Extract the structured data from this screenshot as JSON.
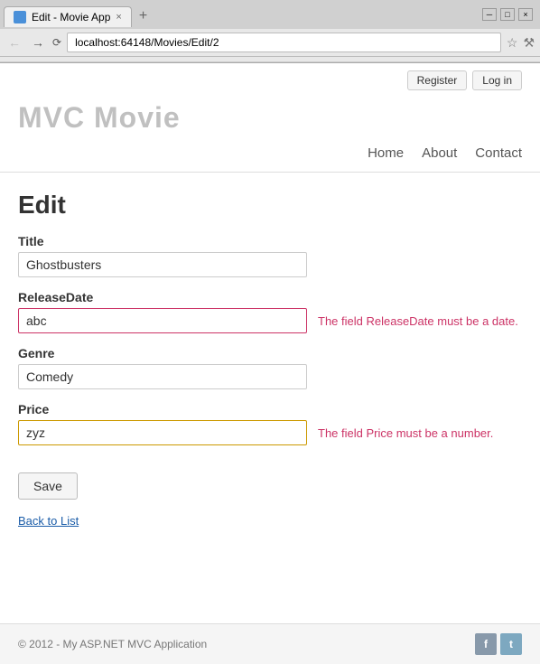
{
  "browser": {
    "tab_title": "Edit - Movie App",
    "tab_close": "×",
    "new_tab": "+",
    "url": "localhost:64148/Movies/Edit/2",
    "win_minimize": "─",
    "win_maximize": "□",
    "win_close": "×"
  },
  "header": {
    "site_title": "MVC Movie",
    "register_label": "Register",
    "login_label": "Log in",
    "nav": {
      "home": "Home",
      "about": "About",
      "contact": "Contact"
    }
  },
  "form": {
    "heading": "Edit",
    "title_label": "Title",
    "title_value": "Ghostbusters",
    "release_label": "ReleaseDate",
    "release_value": "abc",
    "release_error": "The field ReleaseDate must be a date.",
    "genre_label": "Genre",
    "genre_value": "Comedy",
    "price_label": "Price",
    "price_value": "zyz",
    "price_error": "The field Price must be a number.",
    "save_label": "Save",
    "back_label": "Back to List"
  },
  "footer": {
    "copyright": "© 2012 - My ASP.NET MVC Application",
    "facebook": "f",
    "twitter": "t"
  }
}
